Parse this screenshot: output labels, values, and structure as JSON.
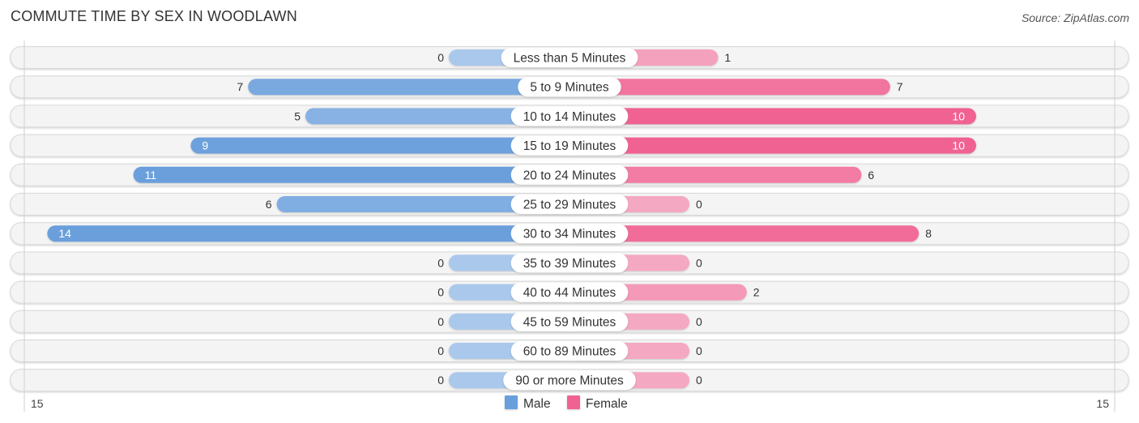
{
  "header": {
    "title": "COMMUTE TIME BY SEX IN WOODLAWN",
    "source": "Source: ZipAtlas.com"
  },
  "chart_data": {
    "type": "bar",
    "orientation": "horizontal-diverging",
    "title": "COMMUTE TIME BY SEX IN WOODLAWN",
    "categories": [
      "Less than 5 Minutes",
      "5 to 9 Minutes",
      "10 to 14 Minutes",
      "15 to 19 Minutes",
      "20 to 24 Minutes",
      "25 to 29 Minutes",
      "30 to 34 Minutes",
      "35 to 39 Minutes",
      "40 to 44 Minutes",
      "45 to 59 Minutes",
      "60 to 89 Minutes",
      "90 or more Minutes"
    ],
    "series": [
      {
        "name": "Male",
        "color": "#6a9fdc",
        "light_color": "#a9c8ec",
        "values": [
          0,
          7,
          5,
          9,
          11,
          6,
          14,
          0,
          0,
          0,
          0,
          0
        ]
      },
      {
        "name": "Female",
        "color": "#f06292",
        "light_color": "#f5a8c2",
        "values": [
          1,
          7,
          10,
          10,
          6,
          0,
          8,
          0,
          2,
          0,
          0,
          0
        ]
      }
    ],
    "axis": {
      "left_label": "15",
      "right_label": "15",
      "max": 15
    },
    "legend": {
      "position": "bottom-center",
      "items": [
        "Male",
        "Female"
      ]
    },
    "xlabel": "",
    "ylabel": ""
  }
}
